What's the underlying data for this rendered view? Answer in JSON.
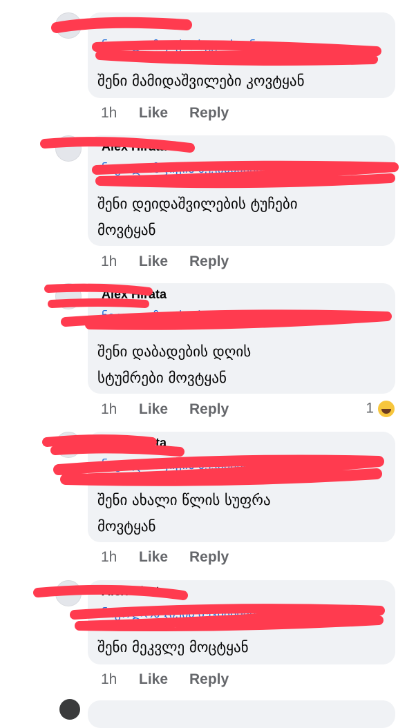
{
  "comments": [
    {
      "author": "Alex Hirata",
      "tag": "ნიკოლოზ ჯიქია სუკიასიანი",
      "lines": [
        "შენი მამიდაშვილები კოვტყან"
      ],
      "time": "1h",
      "like": "Like",
      "reply": "Reply"
    },
    {
      "author": "Alex Hirata",
      "tag": "ნიკოლოზ ჯიქია სუკიასიანი",
      "lines": [
        "შენი დეიდაშვილების ტუჩები",
        "მოვტყან"
      ],
      "time": "1h",
      "like": "Like",
      "reply": "Reply"
    },
    {
      "author": "Alex Hirata",
      "tag": "ნიკოლოზ ჯიქია სუკიასიანი",
      "lines": [
        "შენი დაბადების დღის",
        "სტუმრები მოვტყან"
      ],
      "time": "1h",
      "like": "Like",
      "reply": "Reply",
      "reaction_count": "1"
    },
    {
      "author": "Alex Hirata",
      "tag": "ნიკოლოზ ჯიქია სუკიასიანი",
      "lines": [
        "შენი ახალი წლის სუფრა",
        "მოვტყან"
      ],
      "time": "1h",
      "like": "Like",
      "reply": "Reply"
    },
    {
      "author": "Alex Hirata",
      "tag": "ნიკოლოზ ჯიქია სუკიასიანი",
      "lines": [
        "შენი მეკვლე მოცტყან"
      ],
      "time": "1h",
      "like": "Like",
      "reply": "Reply"
    }
  ],
  "colors": {
    "redaction": "#ff3b4f",
    "bubble": "#f0f2f5",
    "tag": "#216fdb",
    "meta": "#65676b"
  }
}
